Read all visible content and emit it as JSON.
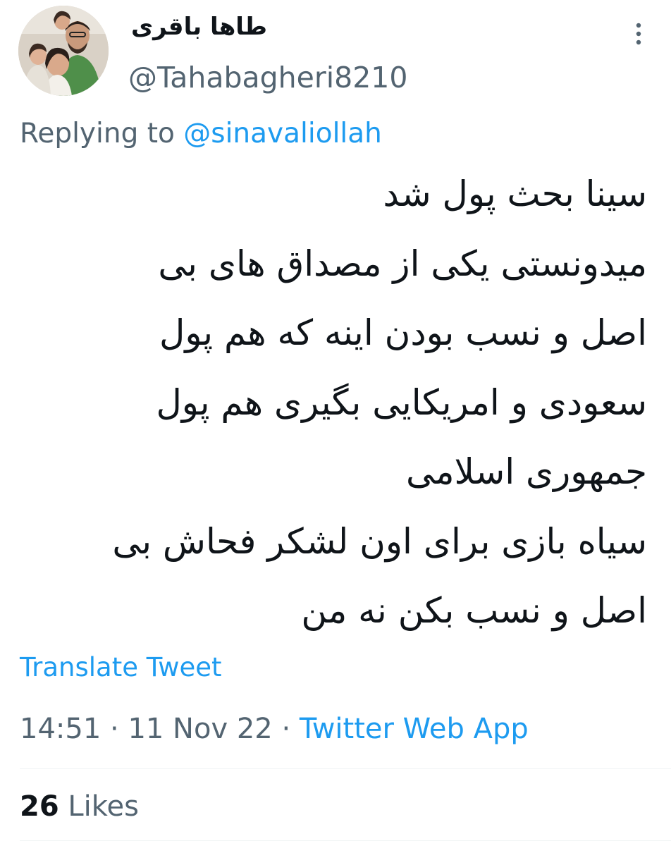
{
  "author": {
    "display_name": "طاها باقری",
    "handle": "@Tahabagheri8210",
    "avatar_icon": "family-photo-avatar"
  },
  "reply": {
    "prefix": "Replying to",
    "mention": "@sinavaliollah"
  },
  "tweet": {
    "lines": [
      "سینا بحث پول شد",
      "میدونستی یکی از مصداق های  بی",
      "اصل  و نسب بودن اینه که هم پول",
      "سعودی و امریکایی بگیری هم پول",
      "جمهوری اسلامی",
      "سیاه بازی برای اون لشکر فحاش بی",
      "اصل و نسب بکن نه من"
    ]
  },
  "translate_label": "Translate Tweet",
  "meta": {
    "time": "14:51",
    "separator": "·",
    "date": "11 Nov 22",
    "source": "Twitter Web App"
  },
  "engagement": {
    "likes_count": "26",
    "likes_label": "Likes"
  },
  "icons": {
    "more": "more-vertical-icon"
  },
  "colors": {
    "link": "#1d9bf0",
    "secondary_text": "#536471",
    "primary_text": "#0f1419",
    "divider": "#eff3f4"
  }
}
